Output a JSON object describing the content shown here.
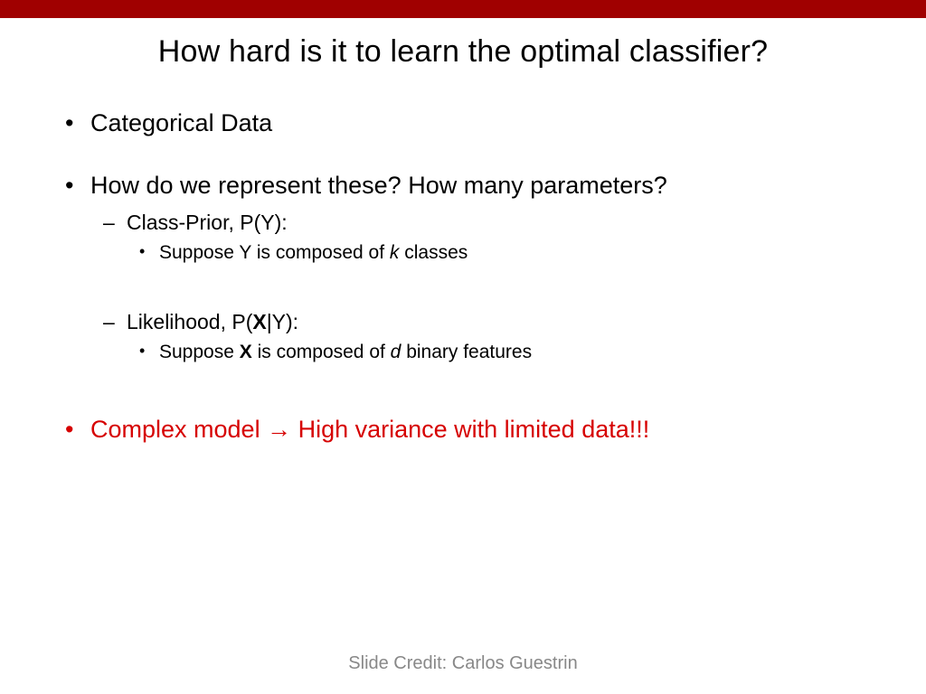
{
  "title": "How hard is it to learn the optimal classifier?",
  "bullets": {
    "b1": "Categorical Data",
    "b2": "How do we represent these? How many parameters?",
    "b2a_prefix": "Class-Prior, P(Y):",
    "b2a_sub_pre": "Suppose Y is composed of ",
    "b2a_sub_k": "k",
    "b2a_sub_post": " classes",
    "b2b_pre": "Likelihood, P(",
    "b2b_x": "X",
    "b2b_post": "|Y):",
    "b2b_sub_pre": "Suppose ",
    "b2b_sub_x": "X",
    "b2b_sub_mid": " is composed of ",
    "b2b_sub_d": "d",
    "b2b_sub_post": " binary features",
    "b3_pre": "Complex model ",
    "b3_arrow": "→",
    "b3_post": " High variance with limited data!!!"
  },
  "credit": "Slide Credit: Carlos Guestrin"
}
